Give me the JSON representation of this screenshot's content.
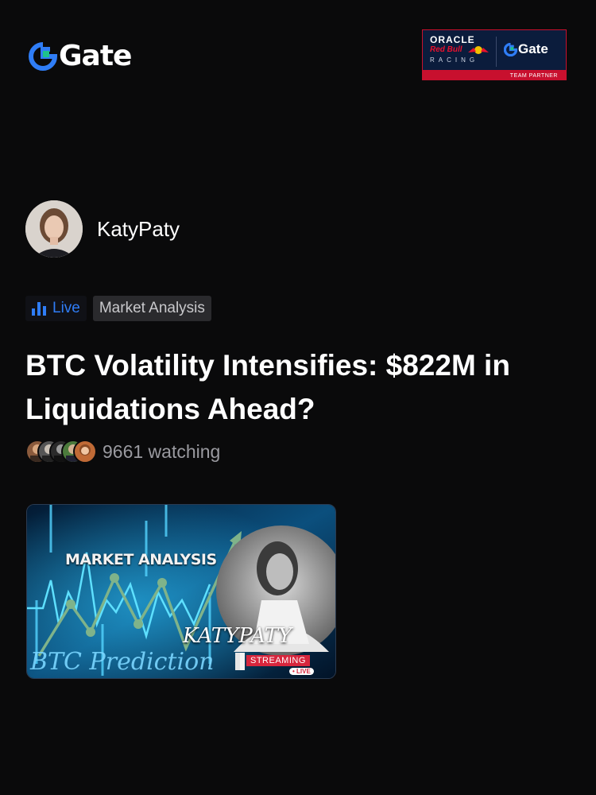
{
  "brand": {
    "name": "Gate",
    "accent": "#2f7df6",
    "green": "#1ec28b"
  },
  "partner_badge": {
    "line1": "ORACLE",
    "line2": "Red Bull",
    "line3": "RACING",
    "brand": "Gate",
    "caption": "TEAM PARTNER"
  },
  "author": {
    "name": "KatyPaty",
    "avatar_icon": "user-photo"
  },
  "tags": {
    "live_label": "Live",
    "topic_label": "Market Analysis"
  },
  "post": {
    "title": "BTC Volatility Intensifies: $822M in Liquidations Ahead?",
    "watching_text": "9661 watching"
  },
  "thumbnail": {
    "heading": "MARKET ANALYSIS",
    "subtitle": "BTC Prediction",
    "streamer": "KATYPATY",
    "badge": "STREAMING",
    "live_pill": "• LIVE"
  }
}
